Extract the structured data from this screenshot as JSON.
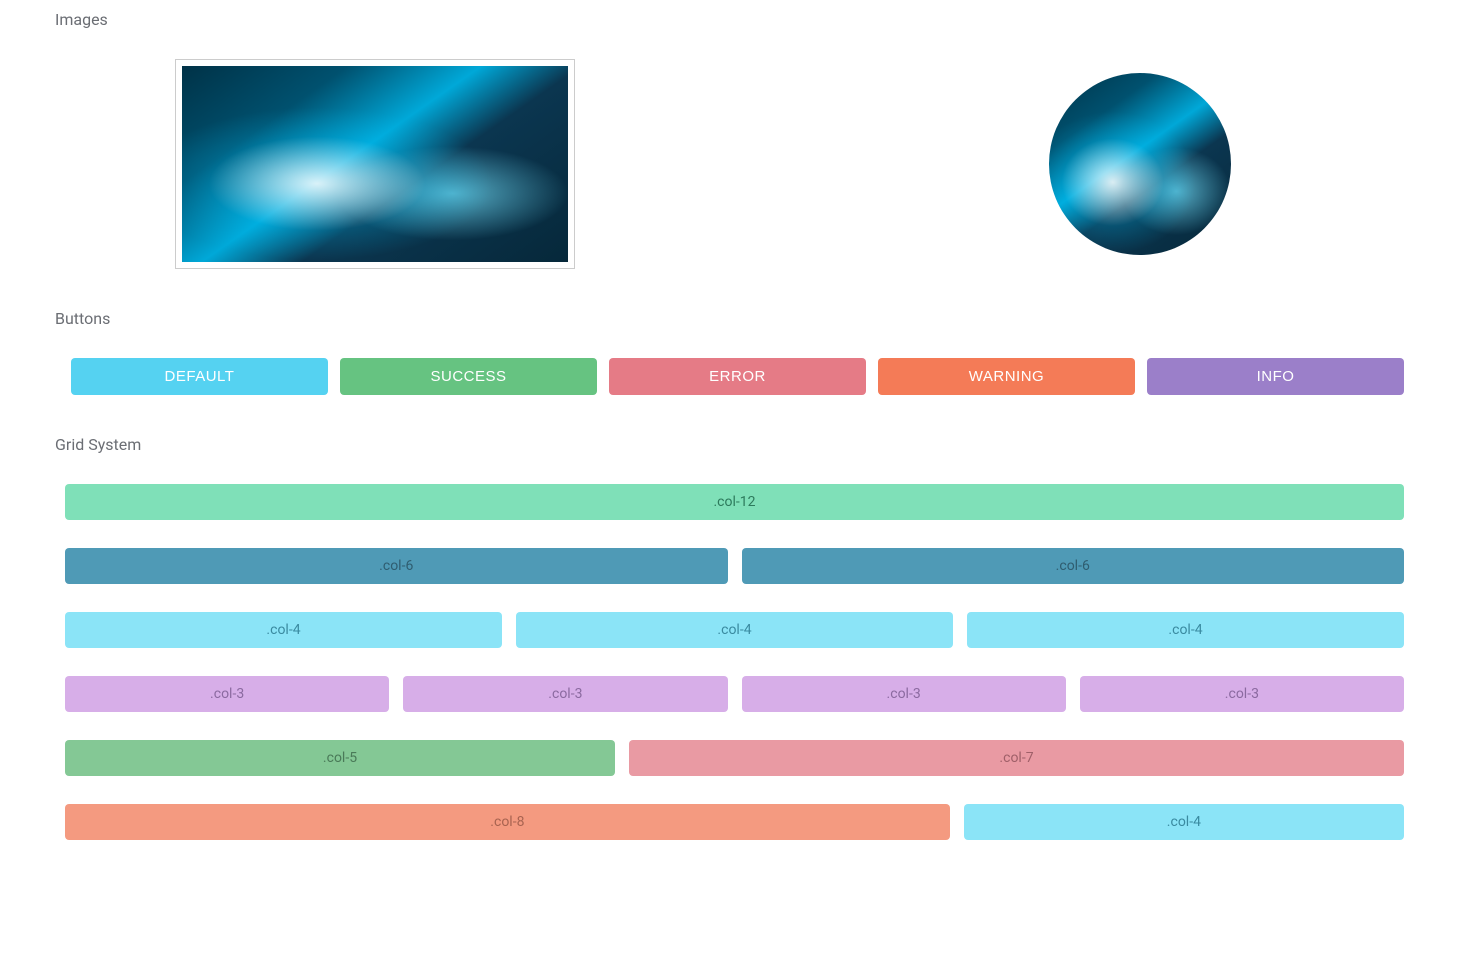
{
  "sections": {
    "images": "Images",
    "buttons": "Buttons",
    "grid": "Grid System"
  },
  "buttons": {
    "default": "DEFAULT",
    "success": "SUCCESS",
    "error": "ERROR",
    "warning": "WARNING",
    "info": "INFO"
  },
  "colors": {
    "default": "#55d2f1",
    "success": "#66c381",
    "error": "#e57b86",
    "warning": "#f47b57",
    "info": "#9b7fc9"
  },
  "grid": {
    "r1": {
      "a": ".col-12"
    },
    "r2": {
      "a": ".col-6",
      "b": ".col-6"
    },
    "r3": {
      "a": ".col-4",
      "b": ".col-4",
      "c": ".col-4"
    },
    "r4": {
      "a": ".col-3",
      "b": ".col-3",
      "c": ".col-3",
      "d": ".col-3"
    },
    "r5": {
      "a": ".col-5",
      "b": ".col-7"
    },
    "r6": {
      "a": ".col-8",
      "b": ".col-4"
    }
  }
}
